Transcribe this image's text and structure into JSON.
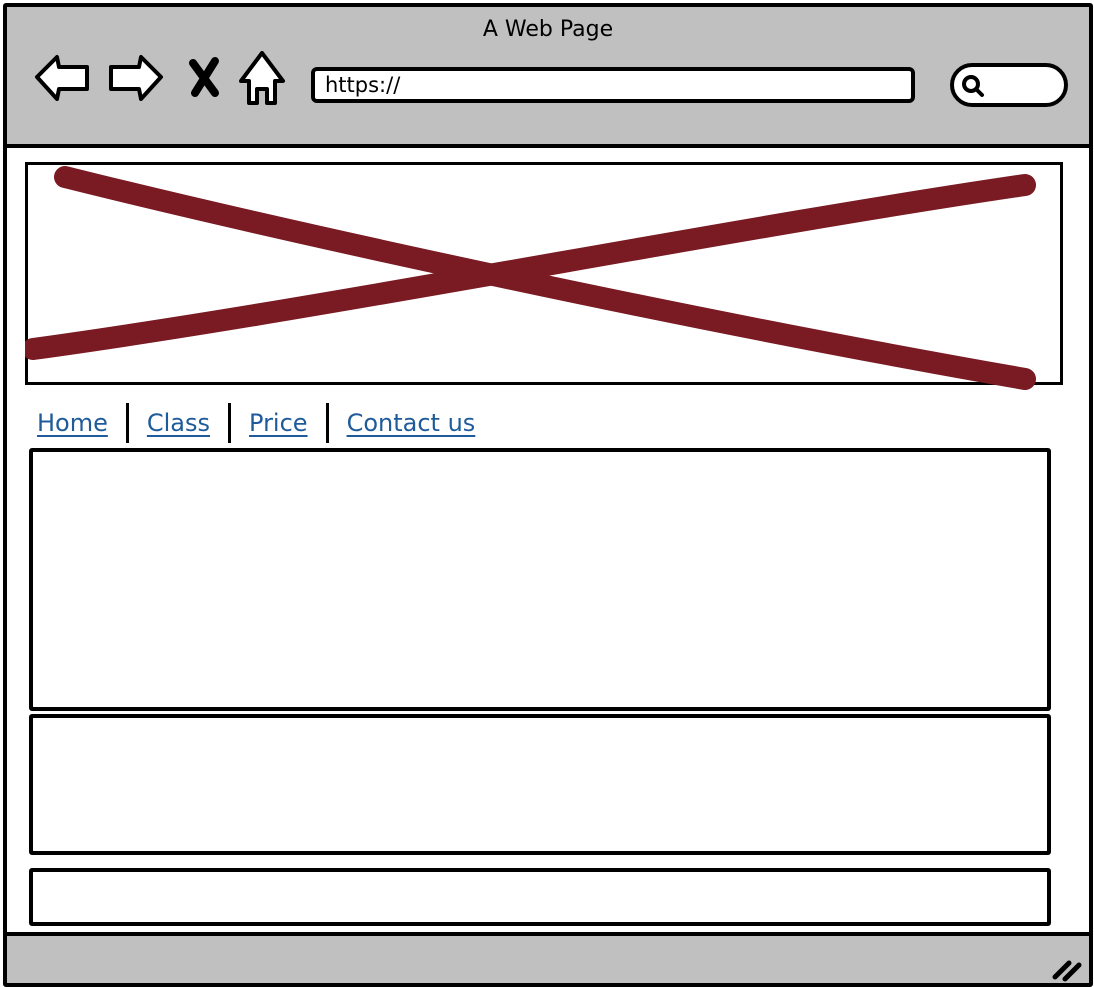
{
  "window": {
    "title": "A Web Page"
  },
  "toolbar": {
    "back_icon": "arrow-left-icon",
    "forward_icon": "arrow-right-icon",
    "stop_icon": "close-icon",
    "home_icon": "home-icon",
    "url_value": "https://",
    "search_icon": "search-icon"
  },
  "hero": {
    "placeholder_icon": "image-placeholder-x",
    "x_color": "#7a1a22"
  },
  "nav": {
    "links": [
      {
        "label": "Home"
      },
      {
        "label": "Class"
      },
      {
        "label": "Price"
      },
      {
        "label": "Contact us"
      }
    ],
    "link_color": "#1f5b9a"
  },
  "colors": {
    "chrome": "#c0c0c0",
    "border": "#000000"
  }
}
